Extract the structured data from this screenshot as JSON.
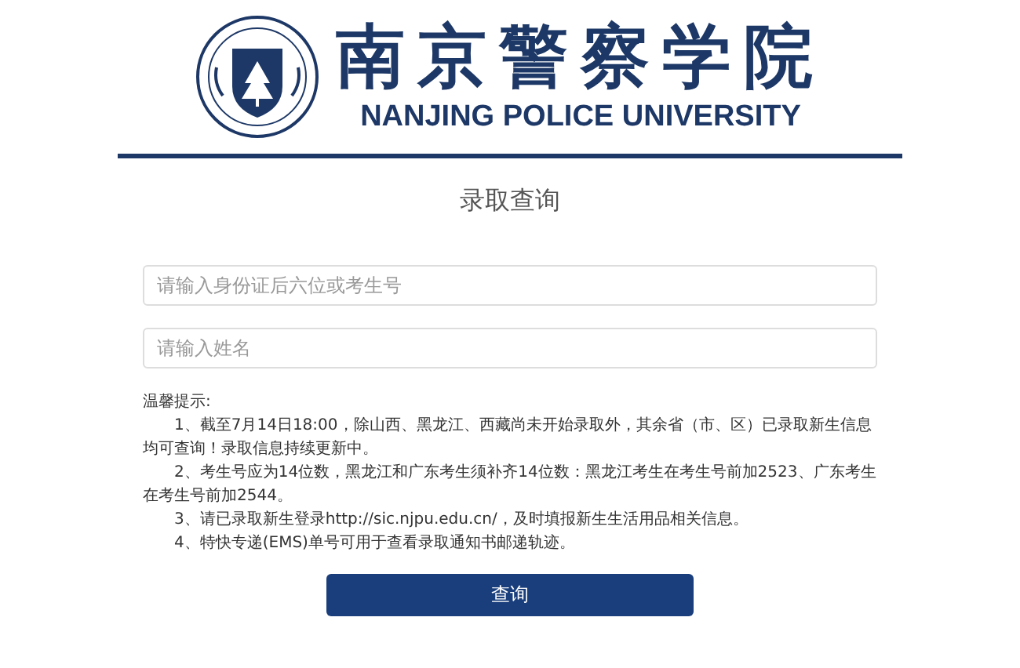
{
  "header": {
    "name_cn": "南京警察学院",
    "name_en": "NANJING POLICE UNIVERSITY"
  },
  "title": "录取查询",
  "fields": [
    {
      "placeholder": "请输入身份证后六位或考生号"
    },
    {
      "placeholder": "请输入姓名"
    }
  ],
  "notice": {
    "heading": "温馨提示:",
    "items": [
      "1、截至7月14日18:00，除山西、黑龙江、西藏尚未开始录取外，其余省（市、区）已录取新生信息均可查询！录取信息持续更新中。",
      "2、考生号应为14位数，黑龙江和广东考生须补齐14位数：黑龙江考生在考生号前加2523、广东考生在考生号前加2544。",
      "3、请已录取新生登录http://sic.njpu.edu.cn/，及时填报新生生活用品相关信息。",
      "4、特快专递(EMS)单号可用于查看录取通知书邮递轨迹。"
    ]
  },
  "button": "查询"
}
